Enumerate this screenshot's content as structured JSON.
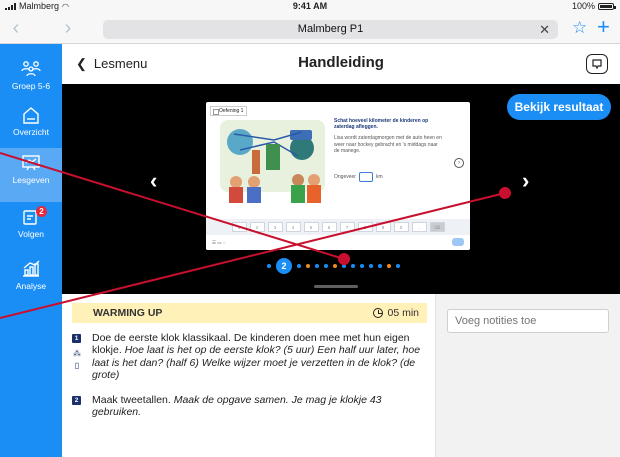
{
  "status_bar": {
    "carrier": "Malmberg",
    "time": "9:41 AM",
    "battery": "100%"
  },
  "browser": {
    "url_title": "Malmberg P1",
    "back_icon": "chevron-left-icon",
    "forward_icon": "chevron-right-icon",
    "clear_icon": "close-icon",
    "favorite_icon": "star-icon",
    "add_icon": "plus-icon"
  },
  "sidebar": {
    "items": [
      {
        "label": "Groep 5-6",
        "icon": "group-icon",
        "active": false
      },
      {
        "label": "Overzicht",
        "icon": "home-icon",
        "active": false
      },
      {
        "label": "Lesgeven",
        "icon": "board-icon",
        "active": true
      },
      {
        "label": "Volgen",
        "icon": "tracking-icon",
        "active": false,
        "badge": "2"
      },
      {
        "label": "Analyse",
        "icon": "chart-icon",
        "active": false
      }
    ]
  },
  "header": {
    "back_label": "Lesmenu",
    "title": "Handleiding",
    "chat_icon": "chat-icon"
  },
  "viewer": {
    "result_button": "Bekijk resultaat",
    "current_page": "2",
    "slide": {
      "tab": "Oefening 1",
      "question": "Schat hoeveel kilometer de kinderen op zaterdag afleggen.",
      "body": "Lisa wordt zaterdagmorgen met de auto heen en weer naar hockey gebracht en 's middags naar de manege.",
      "answer_label": "Ongeveer",
      "answer_unit": "km",
      "keypad": [
        "1",
        "2",
        "3",
        "4",
        "5",
        "6",
        "7",
        "8",
        "9",
        "0",
        ",",
        "⌫"
      ]
    }
  },
  "lesson": {
    "section": "WARMING UP",
    "duration": "05 min",
    "step1_plain": "Doe de eerste klok klassikaal. De kinderen doen mee met hun eigen klokje. ",
    "step1_italic": "Hoe laat is het op de eerste klok? (5 uur) Een half uur later, hoe laat is het dan? (half 6) Welke wijzer moet je verzetten in de klok? (de grote)",
    "step2_plain": "Maak tweetallen. ",
    "step2_italic": "Maak de opgave samen. Je mag je klokje 43 gebruiken.",
    "step1_num": "1",
    "step2_num": "2"
  },
  "notes": {
    "placeholder": "Voeg notities toe"
  },
  "colors": {
    "brand_blue": "#1b8ef5",
    "sidebar_active": "#5aa9f4",
    "badge_red": "#e8283c",
    "pointer_red": "#c8102e",
    "warmup_bg": "#fff1b8",
    "step_num_bg": "#1a2f6b"
  }
}
